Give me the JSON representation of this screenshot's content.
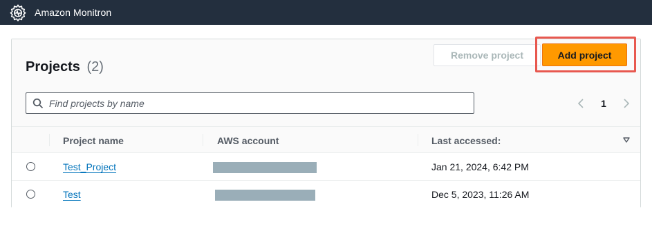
{
  "app": {
    "title": "Amazon Monitron",
    "logo_icon": "monitron-gear-icon",
    "topbar_color": "#232f3e"
  },
  "projects": {
    "heading": "Projects",
    "count": "(2)",
    "remove_button": "Remove project",
    "add_button": "Add project",
    "search_placeholder": "Find projects by name",
    "pagination": {
      "current_page": "1"
    },
    "columns": [
      "Project name",
      "AWS account",
      "Last accessed:"
    ],
    "rows": [
      {
        "name": "Test_Project",
        "aws_account": "",
        "last_accessed": "Jan 21, 2024, 6:42 PM"
      },
      {
        "name": "Test",
        "aws_account": "",
        "last_accessed": "Dec 5, 2023, 11:26 AM"
      }
    ]
  },
  "colors": {
    "accent": "#ff9900",
    "link": "#0073bb",
    "highlight": "#e8584f"
  }
}
